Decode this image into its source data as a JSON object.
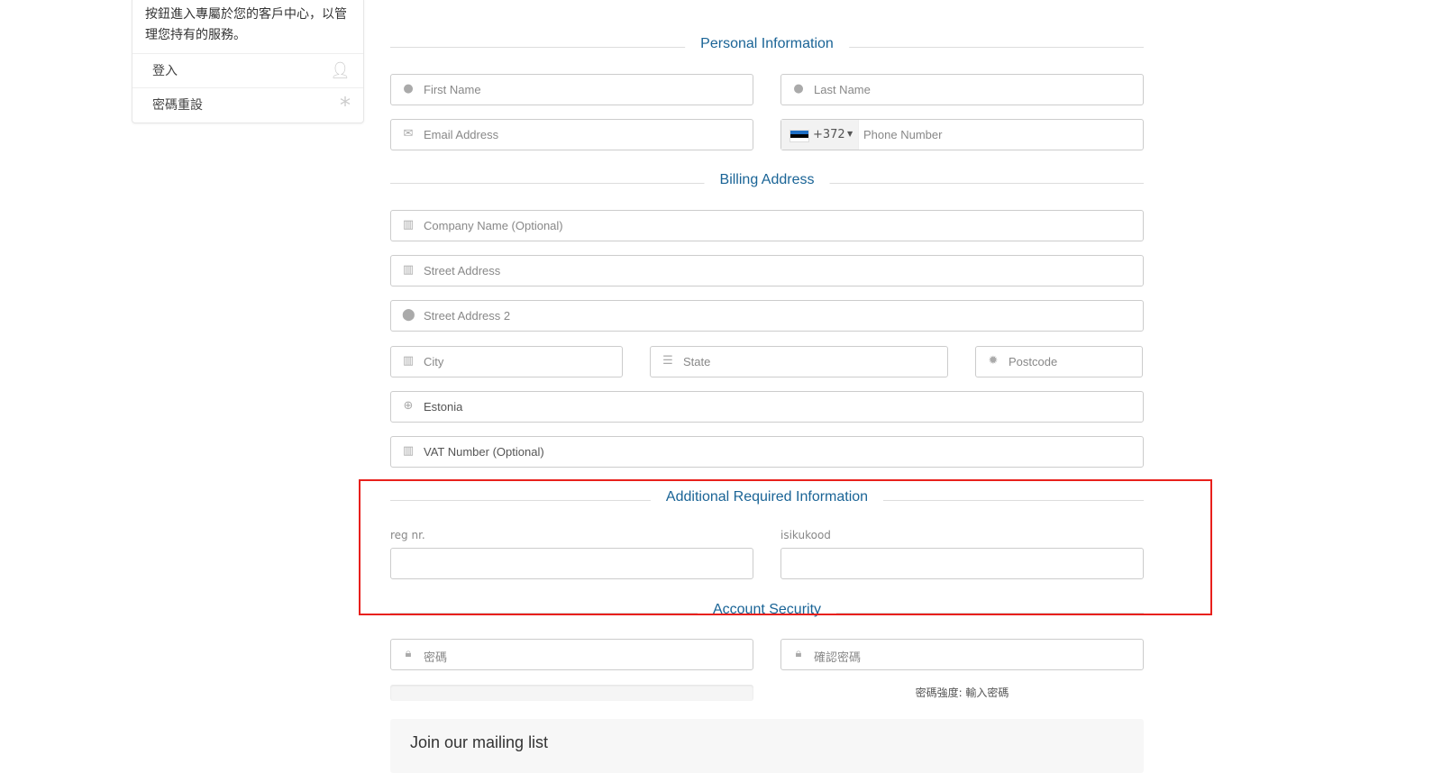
{
  "sidebar": {
    "description": "按鈕進入專屬於您的客戶中心，以管理您持有的服務。",
    "items": [
      {
        "label": "登入",
        "icon": "user-icon"
      },
      {
        "label": "密碼重設",
        "icon": "asterisk-icon"
      }
    ]
  },
  "sections": {
    "personal": "Personal Information",
    "billing": "Billing Address",
    "additional": "Additional Required Information",
    "security": "Account Security"
  },
  "fields": {
    "first_name": "First Name",
    "last_name": "Last Name",
    "email": "Email Address",
    "phone_code": "+372",
    "phone": "Phone Number",
    "company": "Company Name (Optional)",
    "street": "Street Address",
    "street2": "Street Address 2",
    "city": "City",
    "state": "State",
    "postcode": "Postcode",
    "country": "Estonia",
    "vat": "VAT Number (Optional)",
    "reg_label": "reg nr.",
    "isikukood_label": "isikukood",
    "password": "密碼",
    "confirm_password": "確認密碼",
    "strength": "密碼強度: 輸入密碼",
    "strength_percent": 0
  },
  "mailing": {
    "title": "Join our mailing list"
  },
  "colors": {
    "accent": "#1a6496",
    "highlight": "#e8201c"
  }
}
